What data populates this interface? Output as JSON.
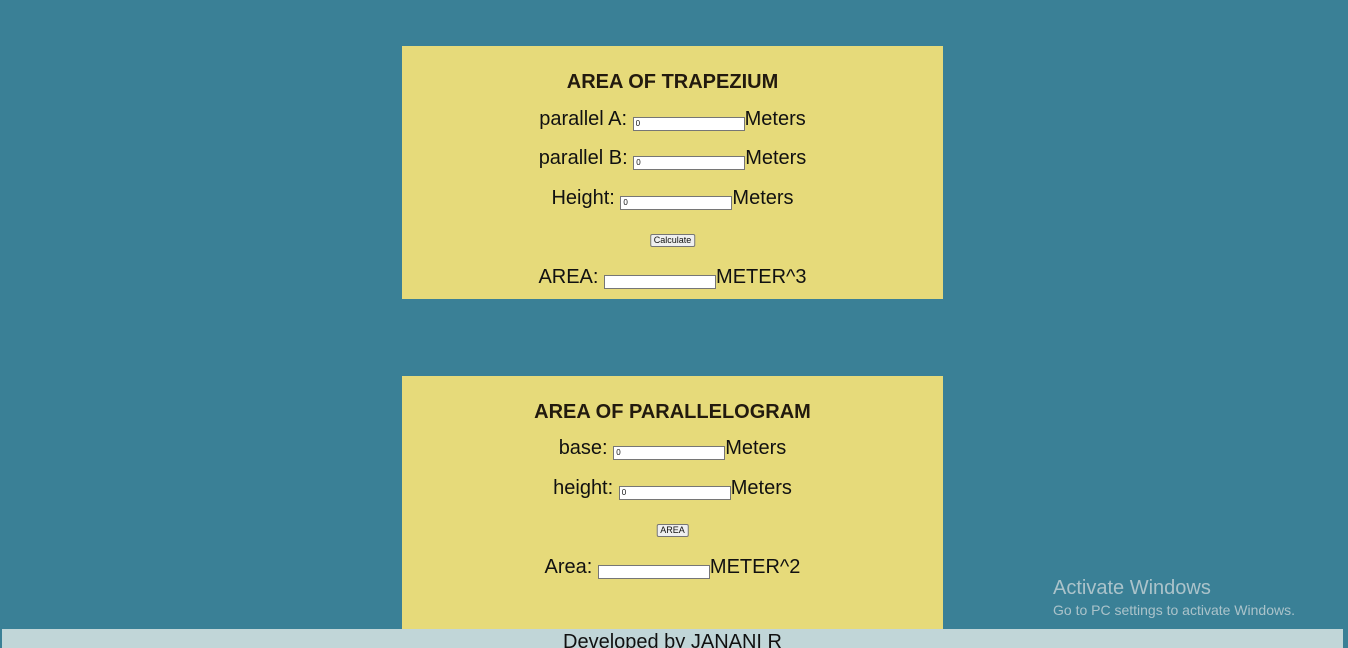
{
  "trapezium": {
    "title": "AREA OF TRAPEZIUM",
    "parallel_a": {
      "label": "parallel A:",
      "value": "0",
      "unit": "Meters"
    },
    "parallel_b": {
      "label": "parallel B:",
      "value": "0",
      "unit": "Meters"
    },
    "height": {
      "label": "Height:",
      "value": "0",
      "unit": "Meters"
    },
    "button_label": "Calculate",
    "result": {
      "label": "AREA:",
      "value": "",
      "unit": "METER^3"
    }
  },
  "parallelogram": {
    "title": "AREA OF PARALLELOGRAM",
    "base": {
      "label": "base:",
      "value": "0",
      "unit": "Meters"
    },
    "height": {
      "label": "height:",
      "value": "0",
      "unit": "Meters"
    },
    "button_label": "AREA",
    "result": {
      "label": "Area:",
      "value": "",
      "unit": "METER^2"
    }
  },
  "footer": {
    "text": "Developed by JANANI R"
  },
  "watermark": {
    "title": "Activate Windows",
    "subtitle": "Go to PC settings to activate Windows."
  },
  "colors": {
    "background": "#3a8096",
    "card": "#e6da7a",
    "footer": "#c1d6d8"
  }
}
